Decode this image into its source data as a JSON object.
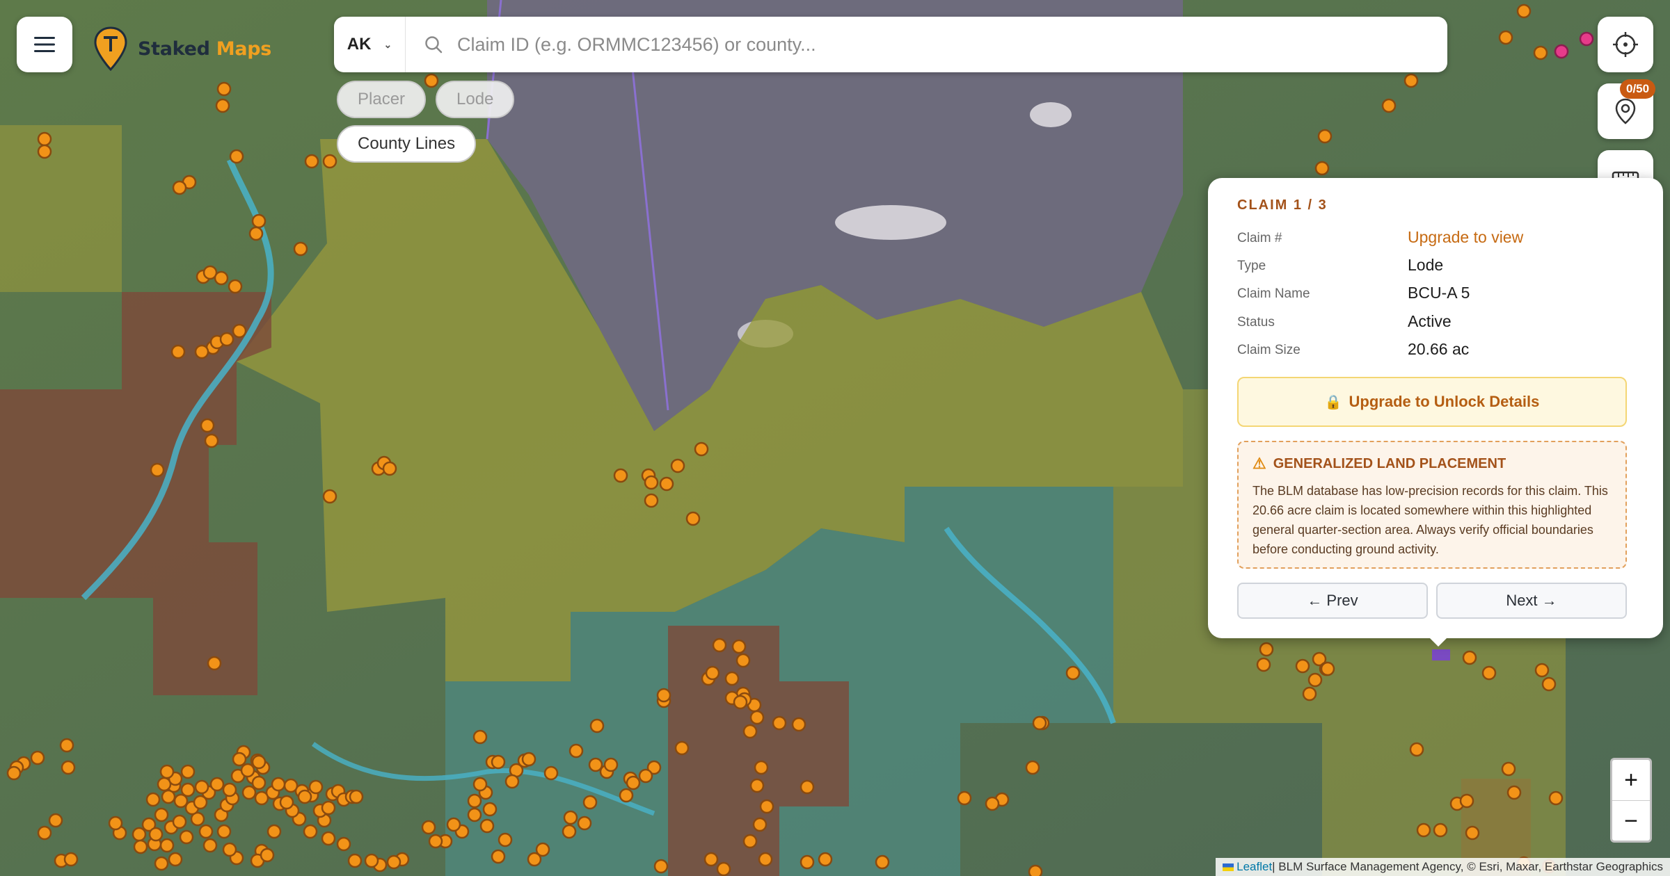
{
  "app": {
    "logo_word1": "Staked",
    "logo_word2": "Maps"
  },
  "search": {
    "state": "AK",
    "placeholder": "Claim ID (e.g. ORMMC123456) or county..."
  },
  "filters": {
    "placer": "Placer",
    "lode": "Lode",
    "county_lines": "County Lines"
  },
  "toolbar": {
    "saved_count": "0/50"
  },
  "popup": {
    "title": "CLAIM 1 / 3",
    "fields": [
      {
        "label": "Claim #",
        "value": "Upgrade to view"
      },
      {
        "label": "Type",
        "value": "Lode"
      },
      {
        "label": "Claim Name",
        "value": "BCU-A 5"
      },
      {
        "label": "Status",
        "value": "Active"
      },
      {
        "label": "Claim Size",
        "value": "20.66 ac"
      }
    ],
    "unlock_label": "Upgrade to Unlock Details",
    "warning_title": "GENERALIZED LAND PLACEMENT",
    "warning_body": "The BLM database has low-precision records for this claim. This 20.66 acre claim is located somewhere within this highlighted general quarter-section area. Always verify official boundaries before conducting ground activity.",
    "prev_label": "← Prev",
    "next_label": "Next →"
  },
  "zoom": {
    "in": "+",
    "out": "−"
  },
  "attribution": {
    "leaflet": "Leaflet",
    "rest": " | BLM Surface Management Agency, © Esri, Maxar, Earthstar Geographics"
  },
  "icons": {
    "menu": "menu-icon",
    "logo": "pin-logo-icon",
    "search": "search-icon",
    "locate": "crosshair-icon",
    "saved": "map-pin-icon",
    "measure": "ruler-icon",
    "qr": "qr-icon",
    "refresh": "refresh-icon",
    "warning": "warning-icon",
    "lock": "lock-icon"
  },
  "colors": {
    "accent": "#f0a020",
    "warning": "#a3521a",
    "claim_dot": "#f29318",
    "badge": "#c95a12"
  }
}
